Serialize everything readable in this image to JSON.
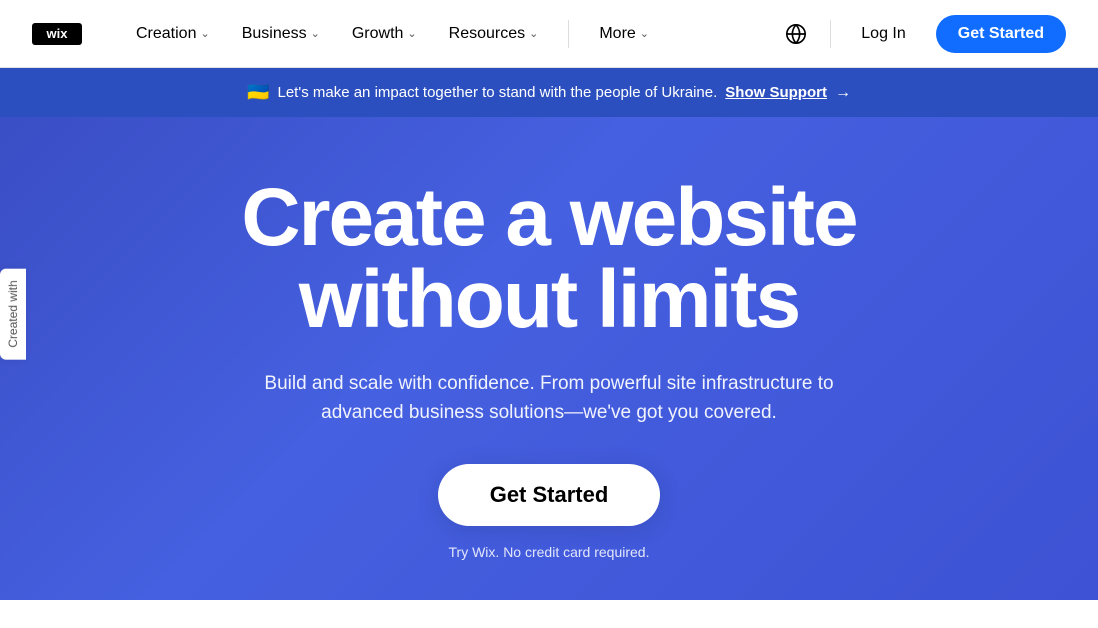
{
  "logo": {
    "text": "wix"
  },
  "navbar": {
    "creation_label": "Creation",
    "business_label": "Business",
    "growth_label": "Growth",
    "resources_label": "Resources",
    "more_label": "More",
    "login_label": "Log In",
    "get_started_label": "Get Started"
  },
  "banner": {
    "flag_emoji": "🇺🇦",
    "text": "Let's make an impact together to stand with the people of Ukraine.",
    "link_text": "Show Support",
    "arrow": "→"
  },
  "hero": {
    "title_line1": "Create a website",
    "title_line2": "without limits",
    "subtitle": "Build and scale with confidence. From powerful site infrastructure to advanced business solutions—we've got you covered.",
    "cta_label": "Get Started",
    "footnote": "Try Wix. No credit card required."
  },
  "side_tab": {
    "text": "Created with"
  },
  "icons": {
    "globe": "🌐",
    "chevron": "⌄"
  }
}
